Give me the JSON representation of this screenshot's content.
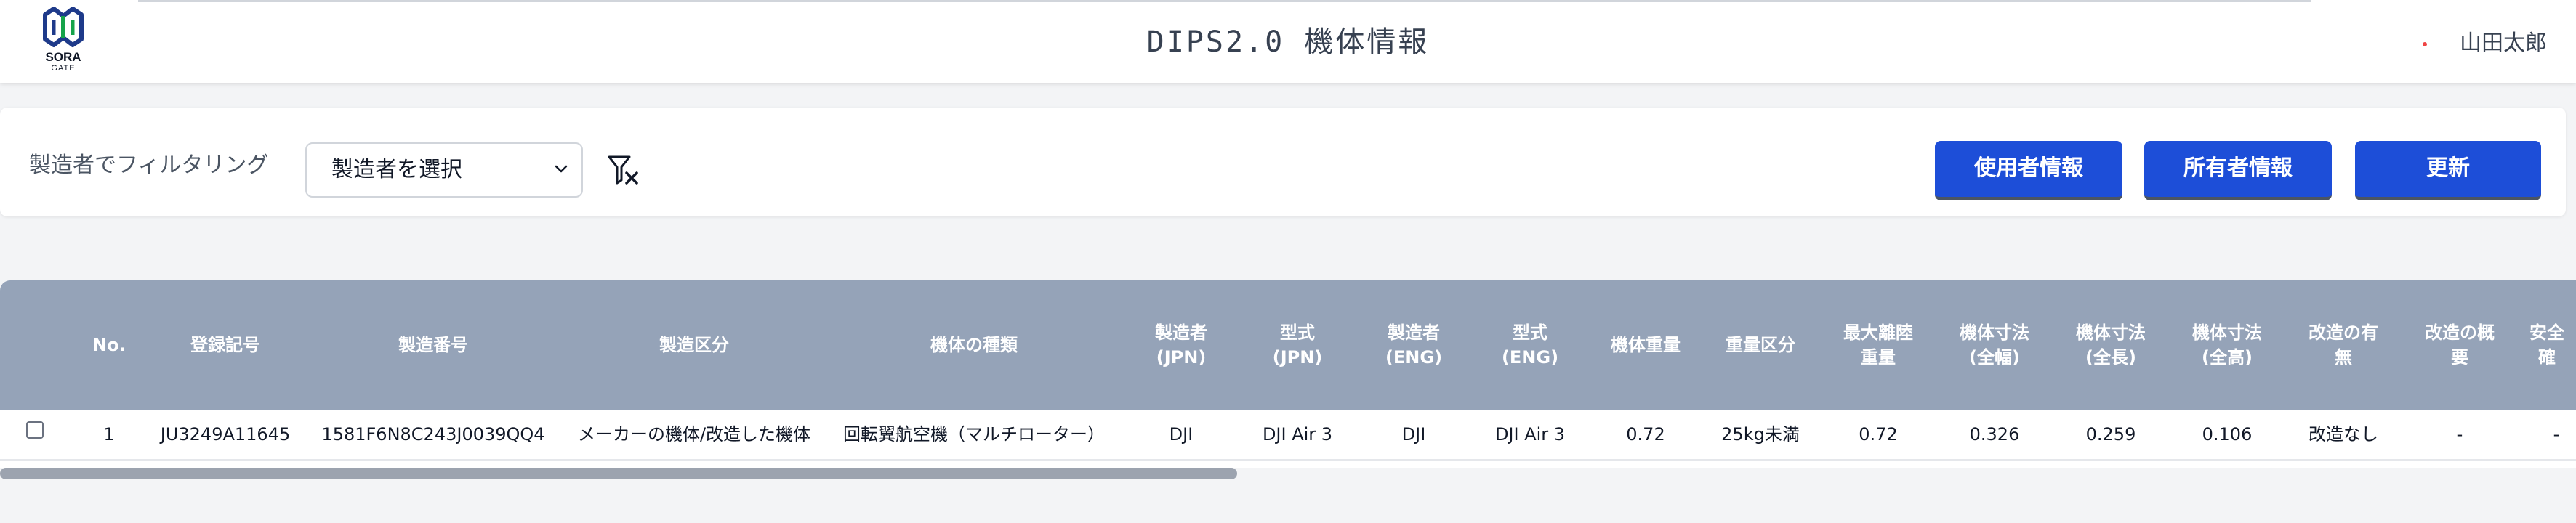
{
  "header": {
    "logo_text": "SORA",
    "logo_sub": "GATE",
    "title": "DIPS2.0 機体情報",
    "user_name": "山田太郎"
  },
  "filter": {
    "label": "製造者でフィルタリング",
    "select_value": "製造者を選択",
    "clear_icon": "filter-clear-icon"
  },
  "buttons": {
    "user_info": "使用者情報",
    "owner_info": "所有者情報",
    "update": "更新"
  },
  "table": {
    "columns": [
      "No.",
      "登録記号",
      "製造番号",
      "製造区分",
      "機体の種類",
      "製造者\n(JPN)",
      "型式\n(JPN)",
      "製造者\n(ENG)",
      "型式\n(ENG)",
      "機体重量",
      "重量区分",
      "最大離陸\n重量",
      "機体寸法\n(全幅)",
      "機体寸法\n(全長)",
      "機体寸法\n(全高)",
      "改造の有\n無",
      "改造の概\n要",
      "安全\n確"
    ],
    "rows": [
      [
        "1",
        "JU3249A11645",
        "1581F6N8C243J0039QQ4",
        "メーカーの機体/改造した機体",
        "回転翼航空機（マルチローター）",
        "DJI",
        "DJI Air 3",
        "DJI",
        "DJI Air 3",
        "0.72",
        "25kg未満",
        "0.72",
        "0.326",
        "0.259",
        "0.106",
        "改造なし",
        "-",
        "-"
      ]
    ]
  },
  "colors": {
    "header_bg": "#95a3b8",
    "button_bg": "#1d4ed8",
    "logo_blue": "#1e3a8a",
    "logo_green": "#16a34a"
  },
  "scrollbar": {
    "position_fraction": 0.0,
    "visible_fraction": 0.48
  }
}
